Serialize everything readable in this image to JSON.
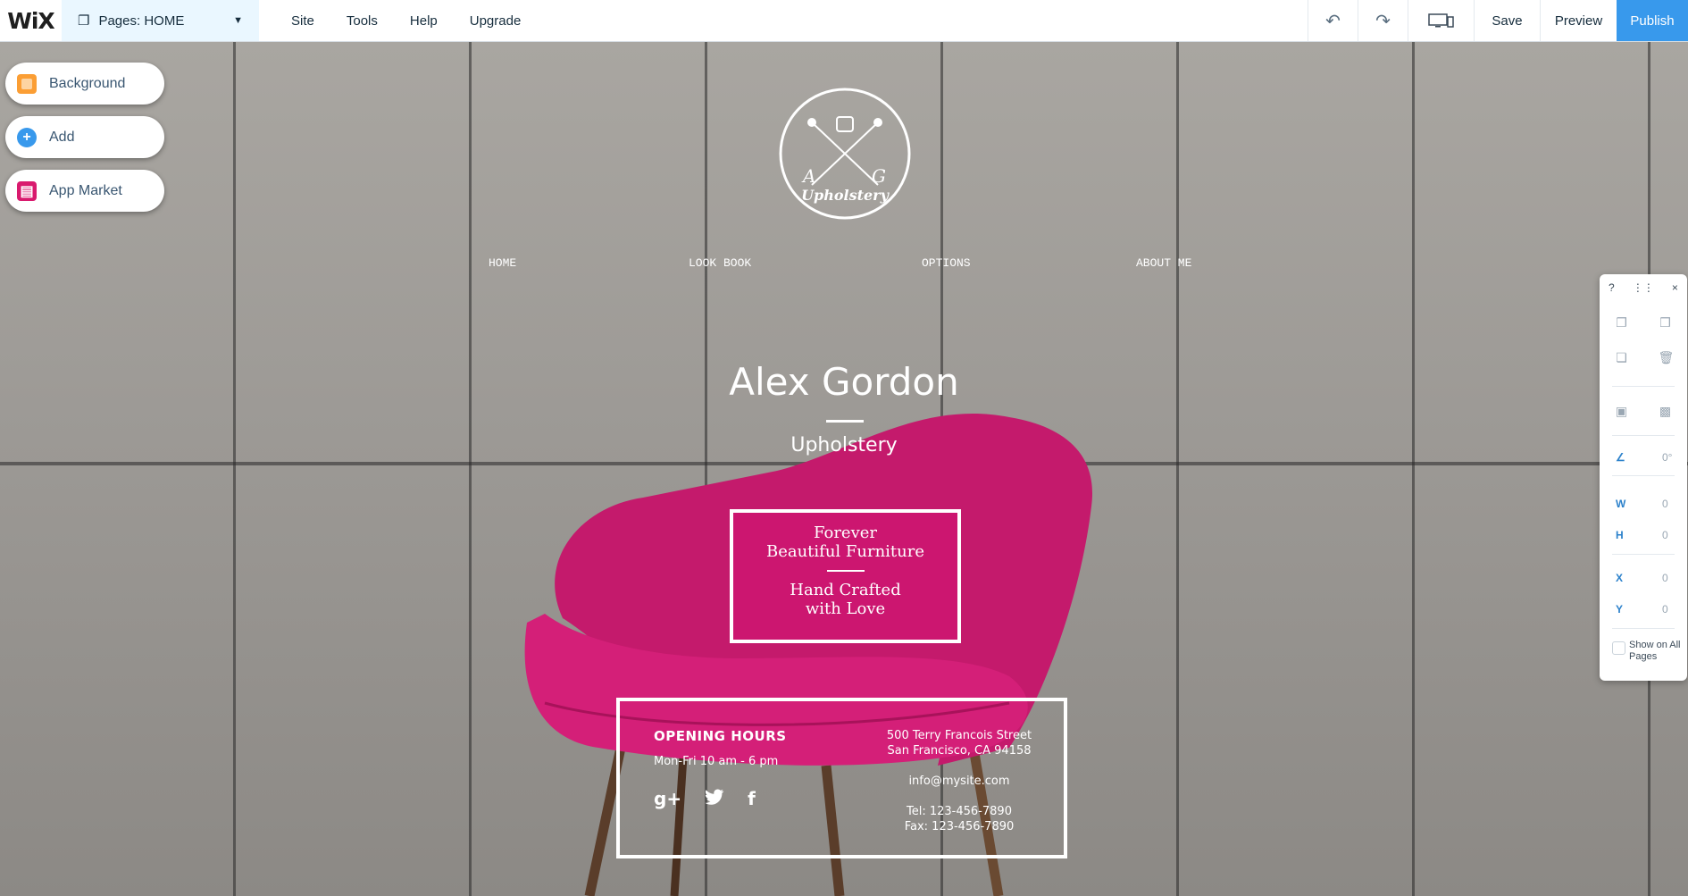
{
  "topbar": {
    "logo": "WiX",
    "pages_label": "Pages: HOME",
    "menu": [
      "Site",
      "Tools",
      "Help",
      "Upgrade"
    ],
    "save": "Save",
    "preview": "Preview",
    "publish": "Publish"
  },
  "left_panel": {
    "background": "Background",
    "add": "Add",
    "app_market": "App Market"
  },
  "site": {
    "logo_text": "Upholstery",
    "logo_a": "A",
    "logo_g": "G",
    "nav": [
      "HOME",
      "LOOK BOOK",
      "OPTIONS",
      "ABOUT ME"
    ],
    "name": "Alex Gordon",
    "subtitle": "Upholstery",
    "tagline_top_1": "Forever",
    "tagline_top_2": "Beautiful Furniture",
    "tagline_bottom_1": "Hand Crafted",
    "tagline_bottom_2": "with Love",
    "opening_hours_title": "OPENING HOURS",
    "opening_hours": "Mon-Fri 10 am - 6 pm",
    "social": [
      "g+",
      "twitter",
      "f"
    ],
    "address_1": "500 Terry Francois Street",
    "address_2": "San Francisco, CA 94158",
    "email": "info@mysite.com",
    "tel": "Tel: 123-456-7890",
    "fax": "Fax: 123-456-7890"
  },
  "right_panel": {
    "help": "?",
    "close": "×",
    "angle": "0°",
    "w_label": "W",
    "w_value": "0",
    "h_label": "H",
    "h_value": "0",
    "x_label": "X",
    "x_value": "0",
    "y_label": "Y",
    "y_value": "0",
    "show_on_all_pages": "Show on All Pages"
  },
  "colors": {
    "accent": "#3899ec",
    "chair_pink": "#cc1670"
  }
}
